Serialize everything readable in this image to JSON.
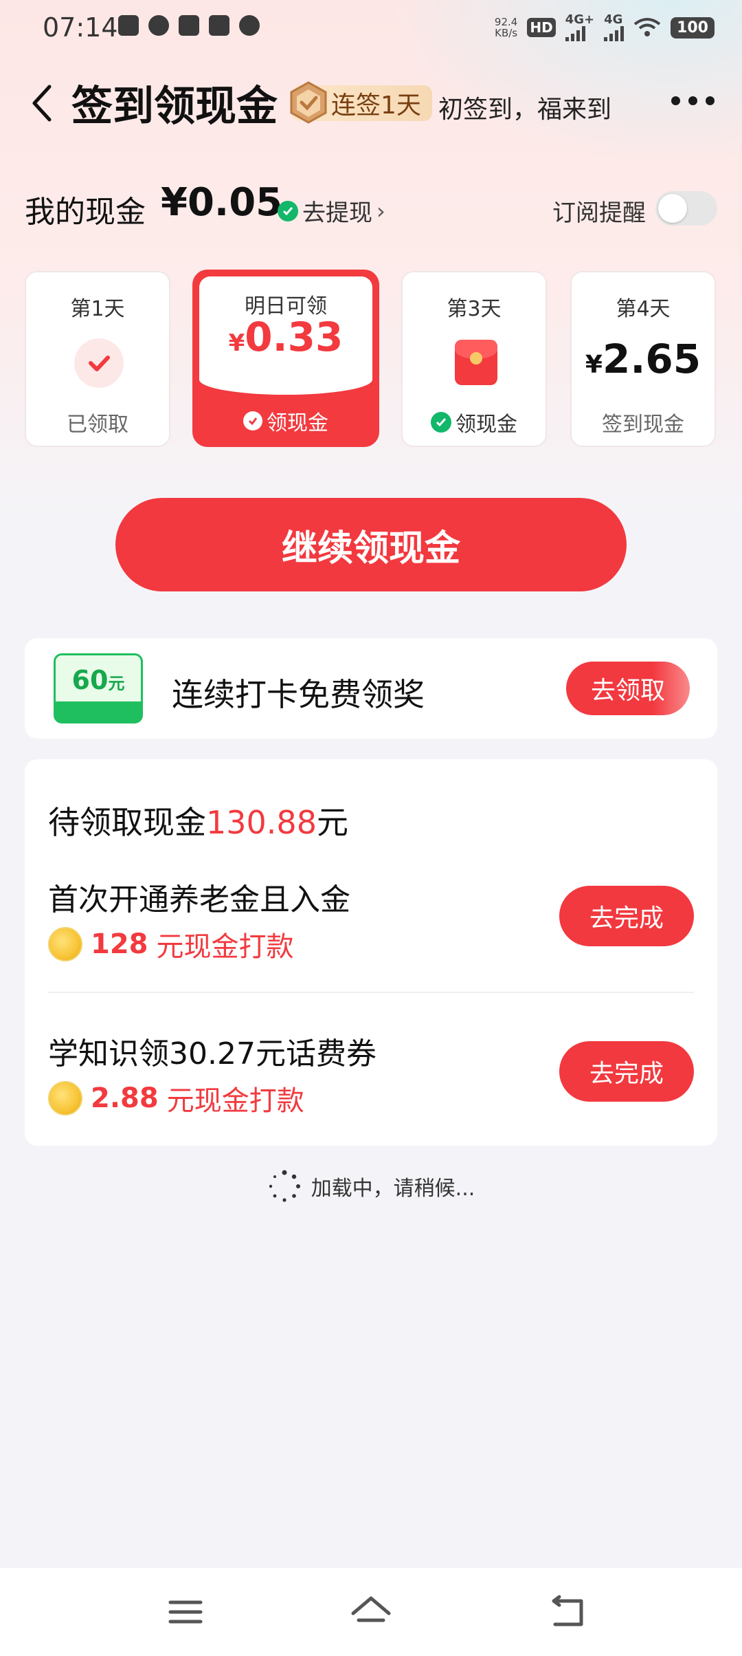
{
  "status_bar": {
    "time": "07:14",
    "net_speed_value": "92.4",
    "net_speed_unit": "KB/s",
    "hd_label": "HD",
    "signal1": "4G+",
    "signal2": "4G",
    "battery": "100"
  },
  "header": {
    "title": "签到领现金",
    "streak_badge": "连签1天",
    "slogan": "初签到，福来到"
  },
  "cash": {
    "label": "我的现金",
    "amount": "¥0.05",
    "withdraw_label": "去提现",
    "subscribe_label": "订阅提醒",
    "subscribe_on": false
  },
  "days": [
    {
      "label": "第1天",
      "footer": "已领取"
    },
    {
      "label": "明日可领",
      "currency": "¥",
      "amount": "0.33",
      "footer": "领现金"
    },
    {
      "label": "第3天",
      "footer": "领现金"
    },
    {
      "label": "第4天",
      "currency": "¥",
      "amount": "2.65",
      "footer": "签到现金"
    }
  ],
  "main_button": "继续领现金",
  "streak_reward": {
    "badge_value": "60",
    "badge_unit": "元",
    "title": "连续打卡免费领奖",
    "button": "去领取"
  },
  "tasks": {
    "pending_prefix": "待领取现金",
    "pending_amount": "130.88",
    "pending_suffix": "元",
    "items": [
      {
        "title": "首次开通养老金且入金",
        "reward_amount": "128",
        "reward_text": "元现金打款",
        "button": "去完成"
      },
      {
        "title": "学知识领30.27元话费券",
        "reward_amount": "2.88",
        "reward_text": "元现金打款",
        "button": "去完成"
      }
    ]
  },
  "loading_text": "加载中，请稍候...",
  "colors": {
    "accent": "#f2393f",
    "success": "#12b76a"
  }
}
